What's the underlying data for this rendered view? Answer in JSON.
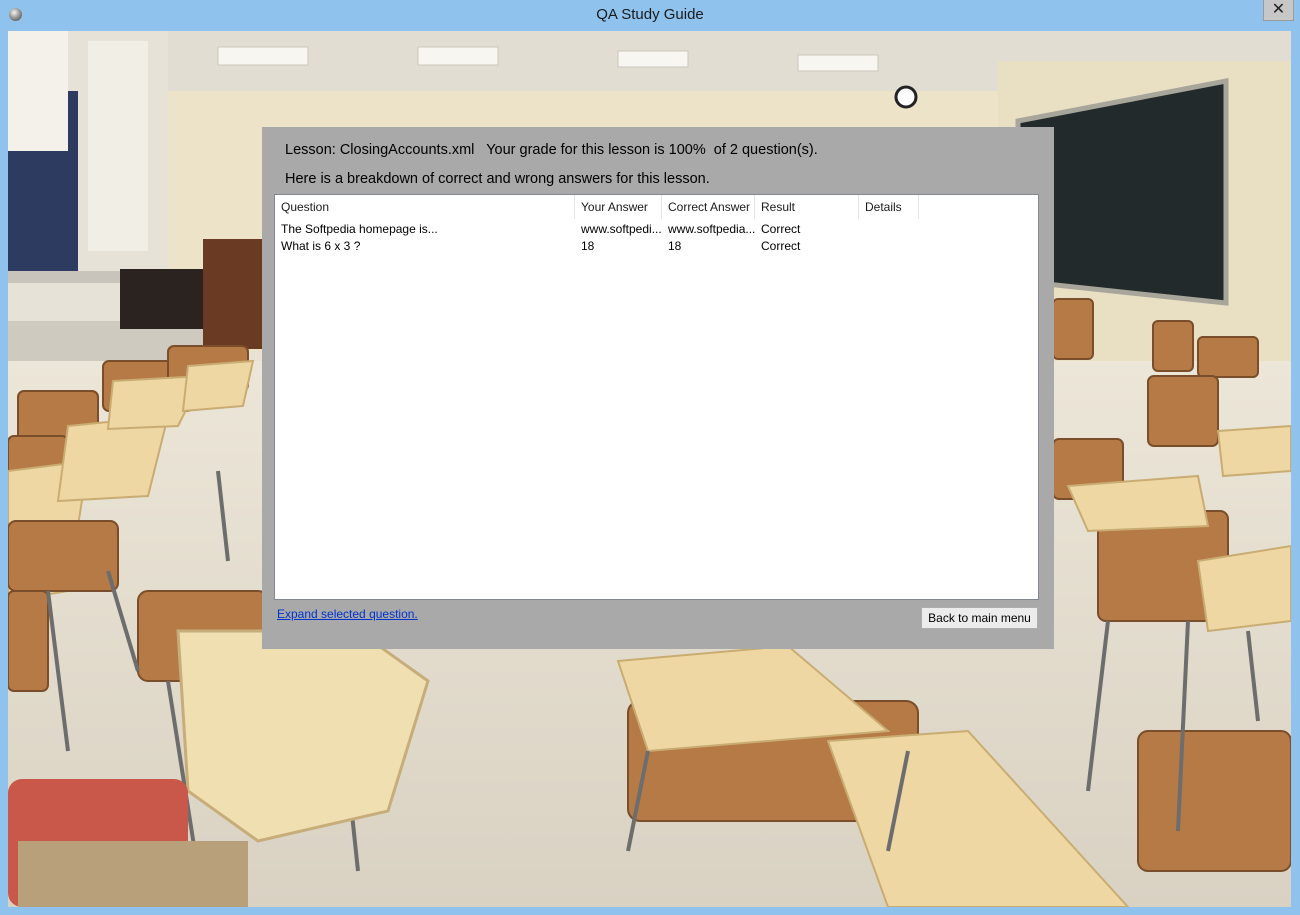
{
  "window": {
    "title": "QA Study Guide",
    "close_glyph": "✕"
  },
  "summary": {
    "lesson_line": "Lesson: ClosingAccounts.xml   Your grade for this lesson is 100%  of 2 question(s).",
    "breakdown_line": "Here is a breakdown of correct and wrong answers for this lesson."
  },
  "table": {
    "columns": [
      "Question",
      "Your Answer",
      "Correct Answer",
      "Result",
      "Details"
    ],
    "rows": [
      [
        "The Softpedia homepage is...",
        "www.softpedi...",
        "www.softpedia...",
        "Correct",
        ""
      ],
      [
        "What is 6 x 3 ?",
        "18",
        "18",
        "Correct",
        ""
      ]
    ]
  },
  "actions": {
    "expand_link": "Expand selected question.",
    "back_button": "Back to main menu"
  },
  "icons": {
    "app": "app-icon",
    "close": "close-icon"
  },
  "colors": {
    "titlebar": "#8fc3ee",
    "panel": "#a9a9a9",
    "link": "#0033cc"
  }
}
